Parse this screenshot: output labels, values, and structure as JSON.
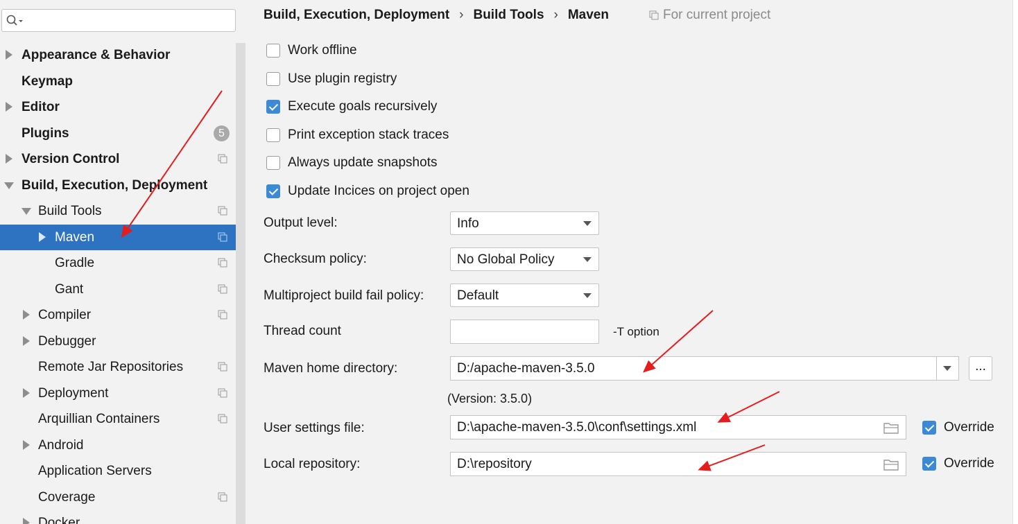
{
  "search": {
    "value": "",
    "placeholder": ""
  },
  "sidebar": {
    "items": [
      {
        "label": "Appearance & Behavior"
      },
      {
        "label": "Keymap"
      },
      {
        "label": "Editor"
      },
      {
        "label": "Plugins",
        "badge": "5"
      },
      {
        "label": "Version Control"
      },
      {
        "label": "Build, Execution, Deployment"
      },
      {
        "label": "Build Tools"
      },
      {
        "label": "Maven"
      },
      {
        "label": "Gradle"
      },
      {
        "label": "Gant"
      },
      {
        "label": "Compiler"
      },
      {
        "label": "Debugger"
      },
      {
        "label": "Remote Jar Repositories"
      },
      {
        "label": "Deployment"
      },
      {
        "label": "Arquillian Containers"
      },
      {
        "label": "Android"
      },
      {
        "label": "Application Servers"
      },
      {
        "label": "Coverage"
      },
      {
        "label": "Docker"
      }
    ]
  },
  "breadcrumb": {
    "parts": [
      "Build, Execution, Deployment",
      "Build Tools",
      "Maven"
    ],
    "separator": "›",
    "for_current_project": "For current project"
  },
  "checkboxes": [
    {
      "label": "Work offline",
      "checked": false
    },
    {
      "label": "Use plugin registry",
      "checked": false
    },
    {
      "label": "Execute goals recursively",
      "checked": true
    },
    {
      "label": "Print exception stack traces",
      "checked": false
    },
    {
      "label": "Always update snapshots",
      "checked": false
    },
    {
      "label": "Update Incices on project open",
      "checked": true
    }
  ],
  "form": {
    "output_level": {
      "label": "Output level:",
      "value": "Info"
    },
    "checksum_policy": {
      "label": "Checksum policy:",
      "value": "No Global Policy"
    },
    "fail_policy": {
      "label": "Multiproject build fail policy:",
      "value": "Default"
    },
    "thread_count": {
      "label": "Thread count",
      "value": "",
      "hint": "-T option"
    },
    "maven_home": {
      "label": "Maven home directory:",
      "value": "D:/apache-maven-3.5.0",
      "browse": "...",
      "version": "(Version: 3.5.0)"
    },
    "user_settings": {
      "label": "User settings file:",
      "value": "D:\\apache-maven-3.5.0\\conf\\settings.xml",
      "override_label": "Override",
      "override_checked": true
    },
    "local_repo": {
      "label": "Local repository:",
      "value": "D:\\repository",
      "override_label": "Override",
      "override_checked": true
    }
  },
  "colors": {
    "selection": "#2d73c1",
    "checkbox_checked": "#3c8ad6",
    "annotation_arrow": "#e41c1c"
  },
  "icons": [
    "search-icon",
    "expand-arrow-icon",
    "collapse-arrow-icon",
    "project-scope-icon",
    "folder-icon",
    "dropdown-arrow-icon"
  ]
}
